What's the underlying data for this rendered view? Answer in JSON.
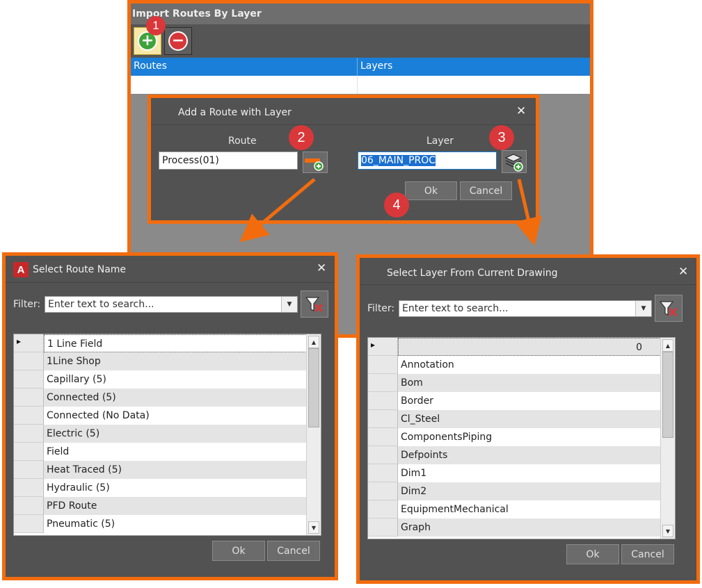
{
  "import_window": {
    "title": "Import Routes By Layer",
    "columns": [
      "Routes",
      "Layers"
    ],
    "add_icon": "add-circle-icon",
    "remove_icon": "remove-circle-icon",
    "badge": "1"
  },
  "add_dialog": {
    "title": "Add a Route with Layer",
    "close": "✕",
    "route_label": "Route",
    "route_value": "Process(01)",
    "layer_label": "Layer",
    "layer_value": "06_MAIN_PROC",
    "ok": "Ok",
    "cancel": "Cancel",
    "badges": [
      "2",
      "3",
      "4"
    ]
  },
  "route_dialog": {
    "title": "Select Route Name",
    "close": "✕",
    "filter_label": "Filter:",
    "filter_placeholder": "Enter text to search...",
    "rows": [
      "1 Line Field",
      "1Line Shop",
      "Capillary (5)",
      "Connected (5)",
      "Connected (No Data)",
      "Electric (5)",
      "Field",
      "Heat Traced (5)",
      "Hydraulic (5)",
      "PFD Route",
      "Pneumatic (5)"
    ],
    "ok": "Ok",
    "cancel": "Cancel"
  },
  "layer_dialog": {
    "title": "Select Layer From Current Drawing",
    "close": "✕",
    "filter_label": "Filter:",
    "filter_placeholder": "Enter text to search...",
    "first_row_value": "0",
    "rows": [
      "Annotation",
      "Bom",
      "Border",
      "Cl_Steel",
      "ComponentsPiping",
      "Defpoints",
      "Dim1",
      "Dim2",
      "EquipmentMechanical",
      "Graph"
    ],
    "ok": "Ok",
    "cancel": "Cancel"
  },
  "colors": {
    "highlight_frame": "#f26c0e",
    "header_blue": "#1a7fd8",
    "dialog_bg": "#525252",
    "badge_red": "#d9373a"
  }
}
